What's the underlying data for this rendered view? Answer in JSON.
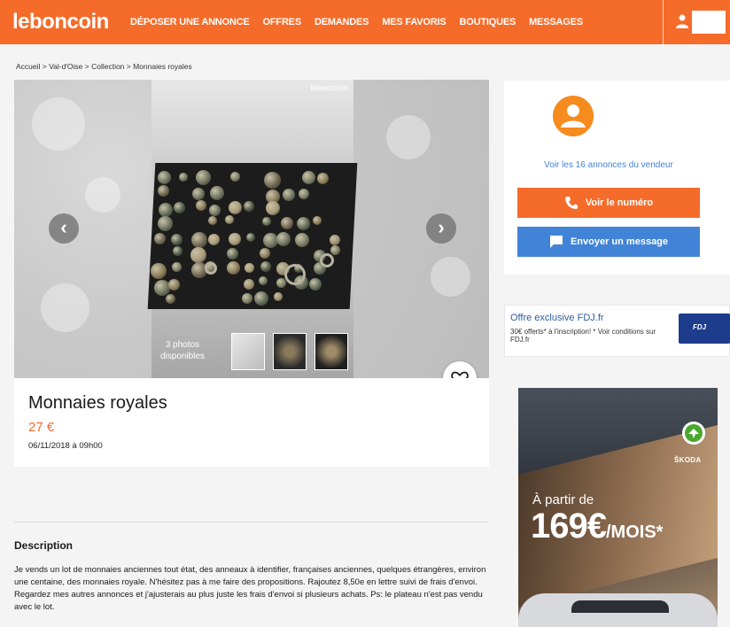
{
  "header": {
    "logo": "leboncoin",
    "nav": [
      "DÉPOSER UNE ANNONCE",
      "OFFRES",
      "DEMANDES",
      "MES FAVORIS",
      "BOUTIQUES",
      "MESSAGES"
    ],
    "user_icon": "user-icon"
  },
  "breadcrumb": "Accueil > Val-d'Oise > Collection > Monnaies royales",
  "gallery": {
    "watermark": "leboncoin",
    "photos_count_line1": "3 photos",
    "photos_count_line2": "disponibles",
    "prev_icon": "chevron-left-icon",
    "next_icon": "chevron-right-icon",
    "favorite_icon": "heart-icon"
  },
  "listing": {
    "title": "Monnaies royales",
    "price": "27 €",
    "date": "06/11/2018 à 09h00"
  },
  "description": {
    "title": "Description",
    "text": "Je vends un lot de monnaies anciennes tout état, des anneaux à identifier, françaises anciennes, quelques étrangères, environ une centaine, des monnaies royale. N'hésitez pas à me faire des propositions. Rajoutez 8,50e en lettre suivi de frais d'envoi. Regardez mes autres annonces et j'ajusterais au plus juste les frais d'envoi si plusieurs achats. Ps: le plateau n'est pas vendu avec le lot."
  },
  "seller": {
    "link": "Voir les 16 annonces du vendeur",
    "call_label": "Voir le numéro",
    "message_label": "Envoyer un message",
    "colors": {
      "call": "#f56b2a",
      "message": "#4183d7",
      "avatar": "#f68b1f"
    }
  },
  "ads": {
    "fdj": {
      "title": "Offre exclusive FDJ.fr",
      "text": "30€ offerts* à l'inscription! * Voir conditions sur FDJ.fr",
      "logo": "FDJ"
    },
    "skoda": {
      "brand": "ŠKODA",
      "line1": "À partir de",
      "price": "169€",
      "unit": "/MOIS*"
    }
  },
  "colors": {
    "brand": "#f56b2a",
    "link": "#4183d7"
  }
}
